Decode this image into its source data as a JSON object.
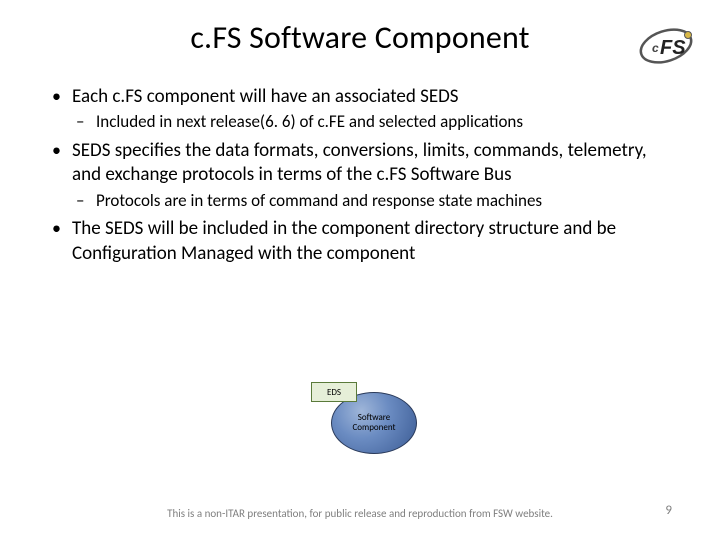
{
  "title": "c.FS Software Component",
  "logo": {
    "text_small": "c",
    "text_big": "FS"
  },
  "bullets": [
    {
      "text": "Each c.FS component will have an associated SEDS",
      "sub": [
        "Included in next release(6. 6) of c.FE and selected applications"
      ]
    },
    {
      "text": "SEDS specifies the data formats, conversions, limits, commands, telemetry, and exchange protocols in terms of the c.FS Software Bus",
      "sub": [
        "Protocols are in terms of command and response state machines"
      ]
    },
    {
      "text": "The SEDS will be included in the component directory structure and be Configuration Managed with the component",
      "sub": []
    }
  ],
  "diagram": {
    "eds_label": "EDS",
    "circle_label": "Software Component"
  },
  "footer": "This is a non-ITAR presentation, for public release and reproduction from FSW website.",
  "page_number": "9"
}
